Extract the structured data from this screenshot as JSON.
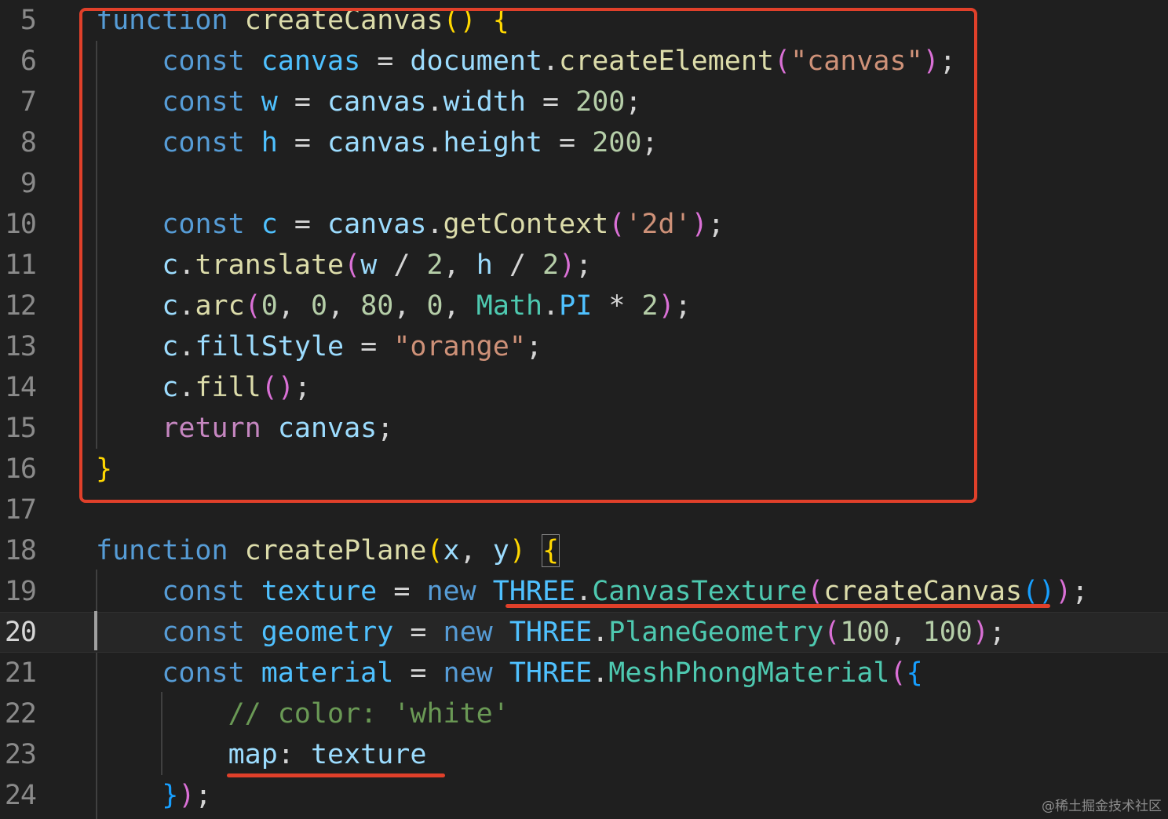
{
  "editor": {
    "active_line": "20",
    "lines": [
      {
        "n": "5",
        "tokens": [
          [
            "kw",
            "function"
          ],
          [
            "p",
            " "
          ],
          [
            "fn",
            "createCanvas"
          ],
          [
            "b1",
            "()"
          ],
          [
            "p",
            " "
          ],
          [
            "b1",
            "{"
          ]
        ]
      },
      {
        "n": "6",
        "tokens": [
          [
            "p",
            "    "
          ],
          [
            "kw",
            "const"
          ],
          [
            "p",
            " "
          ],
          [
            "const",
            "canvas"
          ],
          [
            "p",
            " = "
          ],
          [
            "var",
            "document"
          ],
          [
            "p",
            "."
          ],
          [
            "fn",
            "createElement"
          ],
          [
            "b2",
            "("
          ],
          [
            "str",
            "\"canvas\""
          ],
          [
            "b2",
            ")"
          ],
          [
            "p",
            ";"
          ]
        ]
      },
      {
        "n": "7",
        "tokens": [
          [
            "p",
            "    "
          ],
          [
            "kw",
            "const"
          ],
          [
            "p",
            " "
          ],
          [
            "const",
            "w"
          ],
          [
            "p",
            " = "
          ],
          [
            "var",
            "canvas"
          ],
          [
            "p",
            "."
          ],
          [
            "var",
            "width"
          ],
          [
            "p",
            " = "
          ],
          [
            "num",
            "200"
          ],
          [
            "p",
            ";"
          ]
        ]
      },
      {
        "n": "8",
        "tokens": [
          [
            "p",
            "    "
          ],
          [
            "kw",
            "const"
          ],
          [
            "p",
            " "
          ],
          [
            "const",
            "h"
          ],
          [
            "p",
            " = "
          ],
          [
            "var",
            "canvas"
          ],
          [
            "p",
            "."
          ],
          [
            "var",
            "height"
          ],
          [
            "p",
            " = "
          ],
          [
            "num",
            "200"
          ],
          [
            "p",
            ";"
          ]
        ]
      },
      {
        "n": "9",
        "tokens": []
      },
      {
        "n": "10",
        "tokens": [
          [
            "p",
            "    "
          ],
          [
            "kw",
            "const"
          ],
          [
            "p",
            " "
          ],
          [
            "const",
            "c"
          ],
          [
            "p",
            " = "
          ],
          [
            "var",
            "canvas"
          ],
          [
            "p",
            "."
          ],
          [
            "fn",
            "getContext"
          ],
          [
            "b2",
            "("
          ],
          [
            "str",
            "'2d'"
          ],
          [
            "b2",
            ")"
          ],
          [
            "p",
            ";"
          ]
        ]
      },
      {
        "n": "11",
        "tokens": [
          [
            "p",
            "    "
          ],
          [
            "var",
            "c"
          ],
          [
            "p",
            "."
          ],
          [
            "fn",
            "translate"
          ],
          [
            "b2",
            "("
          ],
          [
            "var",
            "w"
          ],
          [
            "p",
            " / "
          ],
          [
            "num",
            "2"
          ],
          [
            "p",
            ", "
          ],
          [
            "var",
            "h"
          ],
          [
            "p",
            " / "
          ],
          [
            "num",
            "2"
          ],
          [
            "b2",
            ")"
          ],
          [
            "p",
            ";"
          ]
        ]
      },
      {
        "n": "12",
        "tokens": [
          [
            "p",
            "    "
          ],
          [
            "var",
            "c"
          ],
          [
            "p",
            "."
          ],
          [
            "fn",
            "arc"
          ],
          [
            "b2",
            "("
          ],
          [
            "num",
            "0"
          ],
          [
            "p",
            ", "
          ],
          [
            "num",
            "0"
          ],
          [
            "p",
            ", "
          ],
          [
            "num",
            "80"
          ],
          [
            "p",
            ", "
          ],
          [
            "num",
            "0"
          ],
          [
            "p",
            ", "
          ],
          [
            "cls",
            "Math"
          ],
          [
            "p",
            "."
          ],
          [
            "const",
            "PI"
          ],
          [
            "p",
            " * "
          ],
          [
            "num",
            "2"
          ],
          [
            "b2",
            ")"
          ],
          [
            "p",
            ";"
          ]
        ]
      },
      {
        "n": "13",
        "tokens": [
          [
            "p",
            "    "
          ],
          [
            "var",
            "c"
          ],
          [
            "p",
            "."
          ],
          [
            "var",
            "fillStyle"
          ],
          [
            "p",
            " = "
          ],
          [
            "str",
            "\"orange\""
          ],
          [
            "p",
            ";"
          ]
        ]
      },
      {
        "n": "14",
        "tokens": [
          [
            "p",
            "    "
          ],
          [
            "var",
            "c"
          ],
          [
            "p",
            "."
          ],
          [
            "fn",
            "fill"
          ],
          [
            "b2",
            "()"
          ],
          [
            "p",
            ";"
          ]
        ]
      },
      {
        "n": "15",
        "tokens": [
          [
            "p",
            "    "
          ],
          [
            "ctrl",
            "return"
          ],
          [
            "p",
            " "
          ],
          [
            "var",
            "canvas"
          ],
          [
            "p",
            ";"
          ]
        ]
      },
      {
        "n": "16",
        "tokens": [
          [
            "b1",
            "}"
          ]
        ]
      },
      {
        "n": "17",
        "tokens": []
      },
      {
        "n": "18",
        "tokens": [
          [
            "kw",
            "function"
          ],
          [
            "p",
            " "
          ],
          [
            "fn",
            "createPlane"
          ],
          [
            "b1",
            "("
          ],
          [
            "var",
            "x"
          ],
          [
            "p",
            ", "
          ],
          [
            "var",
            "y"
          ],
          [
            "b1",
            ")"
          ],
          [
            "p",
            " "
          ],
          [
            "b1 bm",
            "{"
          ]
        ]
      },
      {
        "n": "19",
        "tokens": [
          [
            "p",
            "    "
          ],
          [
            "kw",
            "const"
          ],
          [
            "p",
            " "
          ],
          [
            "const",
            "texture"
          ],
          [
            "p",
            " = "
          ],
          [
            "kw",
            "new"
          ],
          [
            "p",
            " "
          ],
          [
            "const",
            "THREE"
          ],
          [
            "p",
            "."
          ],
          [
            "cls",
            "CanvasTexture"
          ],
          [
            "b2",
            "("
          ],
          [
            "fn",
            "createCanvas"
          ],
          [
            "b3",
            "()"
          ],
          [
            "b2",
            ")"
          ],
          [
            "p",
            ";"
          ]
        ]
      },
      {
        "n": "20",
        "tokens": [
          [
            "p",
            "    "
          ],
          [
            "kw",
            "const"
          ],
          [
            "p",
            " "
          ],
          [
            "const",
            "geometry"
          ],
          [
            "p",
            " = "
          ],
          [
            "kw",
            "new"
          ],
          [
            "p",
            " "
          ],
          [
            "const",
            "THREE"
          ],
          [
            "p",
            "."
          ],
          [
            "cls",
            "PlaneGeometry"
          ],
          [
            "b2",
            "("
          ],
          [
            "num",
            "100"
          ],
          [
            "p",
            ", "
          ],
          [
            "num",
            "100"
          ],
          [
            "b2",
            ")"
          ],
          [
            "p",
            ";"
          ]
        ]
      },
      {
        "n": "21",
        "tokens": [
          [
            "p",
            "    "
          ],
          [
            "kw",
            "const"
          ],
          [
            "p",
            " "
          ],
          [
            "const",
            "material"
          ],
          [
            "p",
            " = "
          ],
          [
            "kw",
            "new"
          ],
          [
            "p",
            " "
          ],
          [
            "const",
            "THREE"
          ],
          [
            "p",
            "."
          ],
          [
            "cls",
            "MeshPhongMaterial"
          ],
          [
            "b2",
            "("
          ],
          [
            "b3",
            "{"
          ]
        ]
      },
      {
        "n": "22",
        "tokens": [
          [
            "p",
            "        "
          ],
          [
            "cmt",
            "// color: 'white'"
          ]
        ]
      },
      {
        "n": "23",
        "tokens": [
          [
            "p",
            "        "
          ],
          [
            "var",
            "map"
          ],
          [
            "p",
            ": "
          ],
          [
            "var",
            "texture"
          ]
        ]
      },
      {
        "n": "24",
        "tokens": [
          [
            "p",
            "    "
          ],
          [
            "b3",
            "}"
          ],
          [
            "b2",
            ")"
          ],
          [
            "p",
            ";"
          ]
        ]
      }
    ]
  },
  "watermark": "@稀土掘金技术社区"
}
